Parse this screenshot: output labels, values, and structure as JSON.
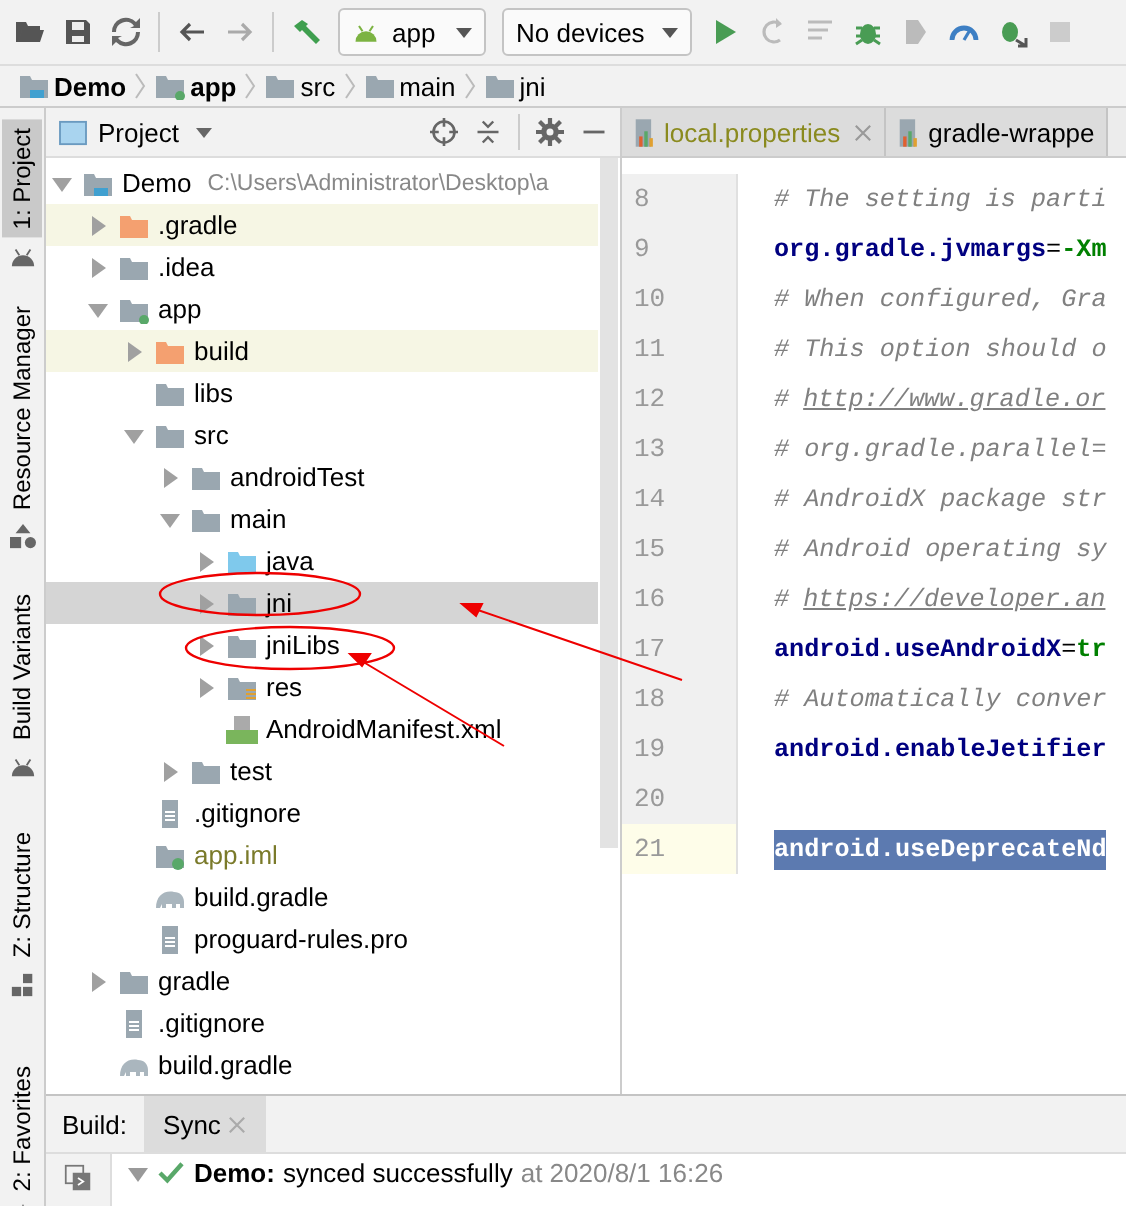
{
  "toolbar": {
    "config": "app",
    "device": "No devices"
  },
  "breadcrumb": [
    {
      "label": "Demo",
      "kind": "project"
    },
    {
      "label": "app",
      "kind": "module"
    },
    {
      "label": "src",
      "kind": "folder"
    },
    {
      "label": "main",
      "kind": "folder"
    },
    {
      "label": "jni",
      "kind": "folder"
    }
  ],
  "stripe": [
    {
      "label": "1: Project",
      "selected": true
    },
    {
      "label": "Resource Manager",
      "selected": false
    },
    {
      "label": "Build Variants",
      "selected": false
    },
    {
      "label": "Z: Structure",
      "selected": false
    },
    {
      "label": "2: Favorites",
      "selected": false
    }
  ],
  "project_panel": {
    "title": "Project",
    "tree": [
      {
        "name": "Demo",
        "path": "C:\\Users\\Administrator\\Desktop\\a",
        "kind": "project",
        "expanded": true,
        "selected": false,
        "children": [
          {
            "name": ".gradle",
            "kind": "excluded",
            "expanded": false,
            "selected": false
          },
          {
            "name": ".idea",
            "kind": "folder",
            "expanded": false,
            "selected": false
          },
          {
            "name": "app",
            "kind": "module",
            "expanded": true,
            "selected": false,
            "children": [
              {
                "name": "build",
                "kind": "excluded",
                "expanded": false,
                "selected": false
              },
              {
                "name": "libs",
                "kind": "folder",
                "selected": false
              },
              {
                "name": "src",
                "kind": "folder",
                "expanded": true,
                "selected": false,
                "children": [
                  {
                    "name": "androidTest",
                    "kind": "folder",
                    "expanded": false,
                    "selected": false
                  },
                  {
                    "name": "main",
                    "kind": "folder",
                    "expanded": true,
                    "selected": false,
                    "children": [
                      {
                        "name": "java",
                        "kind": "source",
                        "expanded": false,
                        "selected": false
                      },
                      {
                        "name": "jni",
                        "kind": "folder",
                        "expanded": false,
                        "selected": true
                      },
                      {
                        "name": "jniLibs",
                        "kind": "folder",
                        "expanded": false,
                        "selected": false
                      },
                      {
                        "name": "res",
                        "kind": "resources",
                        "expanded": false,
                        "selected": false
                      },
                      {
                        "name": "AndroidManifest.xml",
                        "kind": "manifest",
                        "selected": false
                      }
                    ]
                  },
                  {
                    "name": "test",
                    "kind": "folder",
                    "expanded": false,
                    "selected": false
                  }
                ]
              },
              {
                "name": ".gitignore",
                "kind": "text",
                "selected": false
              },
              {
                "name": "app.iml",
                "kind": "iml",
                "selected": false
              },
              {
                "name": "build.gradle",
                "kind": "gradle",
                "selected": false
              },
              {
                "name": "proguard-rules.pro",
                "kind": "text",
                "selected": false
              }
            ]
          },
          {
            "name": "gradle",
            "kind": "folder",
            "expanded": false,
            "selected": false
          },
          {
            "name": ".gitignore",
            "kind": "text",
            "selected": false
          },
          {
            "name": "build.gradle",
            "kind": "gradle",
            "selected": false
          }
        ]
      }
    ]
  },
  "editor": {
    "tabs": [
      {
        "label": "local.properties",
        "closable": true,
        "selected": false
      },
      {
        "label": "gradle-wrappe",
        "closable": false,
        "selected": false
      }
    ],
    "lines": [
      {
        "number": "8",
        "kind": "comment",
        "text": "# The setting is parti",
        "selected": false
      },
      {
        "number": "9",
        "kind": "property",
        "key": "org.gradle.jvmargs",
        "op": "=",
        "value": "-Xm",
        "selected": false
      },
      {
        "number": "10",
        "kind": "comment",
        "text": "# When configured, Gra",
        "selected": false
      },
      {
        "number": "11",
        "kind": "comment",
        "text": "# This option should o",
        "selected": false
      },
      {
        "number": "12",
        "kind": "link",
        "text": "#",
        "link": "http://www.gradle.or",
        "selected": false
      },
      {
        "number": "13",
        "kind": "comment",
        "text": "# org.gradle.parallel=",
        "selected": false
      },
      {
        "number": "14",
        "kind": "comment",
        "text": "# AndroidX package str",
        "selected": false
      },
      {
        "number": "15",
        "kind": "comment",
        "text": "# Android operating sy",
        "selected": false
      },
      {
        "number": "16",
        "kind": "link",
        "text": "#",
        "link": "https://developer.an",
        "selected": false
      },
      {
        "number": "17",
        "kind": "property",
        "key": "android.useAndroidX",
        "op": "=",
        "value": "tr",
        "selected": false
      },
      {
        "number": "18",
        "kind": "comment",
        "text": "# Automatically conver",
        "selected": false
      },
      {
        "number": "19",
        "kind": "property",
        "key": "android.enableJetifier",
        "selected": false
      },
      {
        "number": "20",
        "kind": "blank",
        "selected": false
      },
      {
        "number": "21",
        "kind": "property",
        "key": "android.useDeprecateNd",
        "selected": true
      }
    ]
  },
  "build_panel": {
    "label": "Build:",
    "tabs": [
      {
        "label": "Sync",
        "closable": true,
        "selected": true
      }
    ],
    "rows": [
      {
        "title": "Demo:",
        "message": "synced successfully",
        "time": "at 2020/8/1 16:26",
        "expanded": true
      }
    ]
  }
}
